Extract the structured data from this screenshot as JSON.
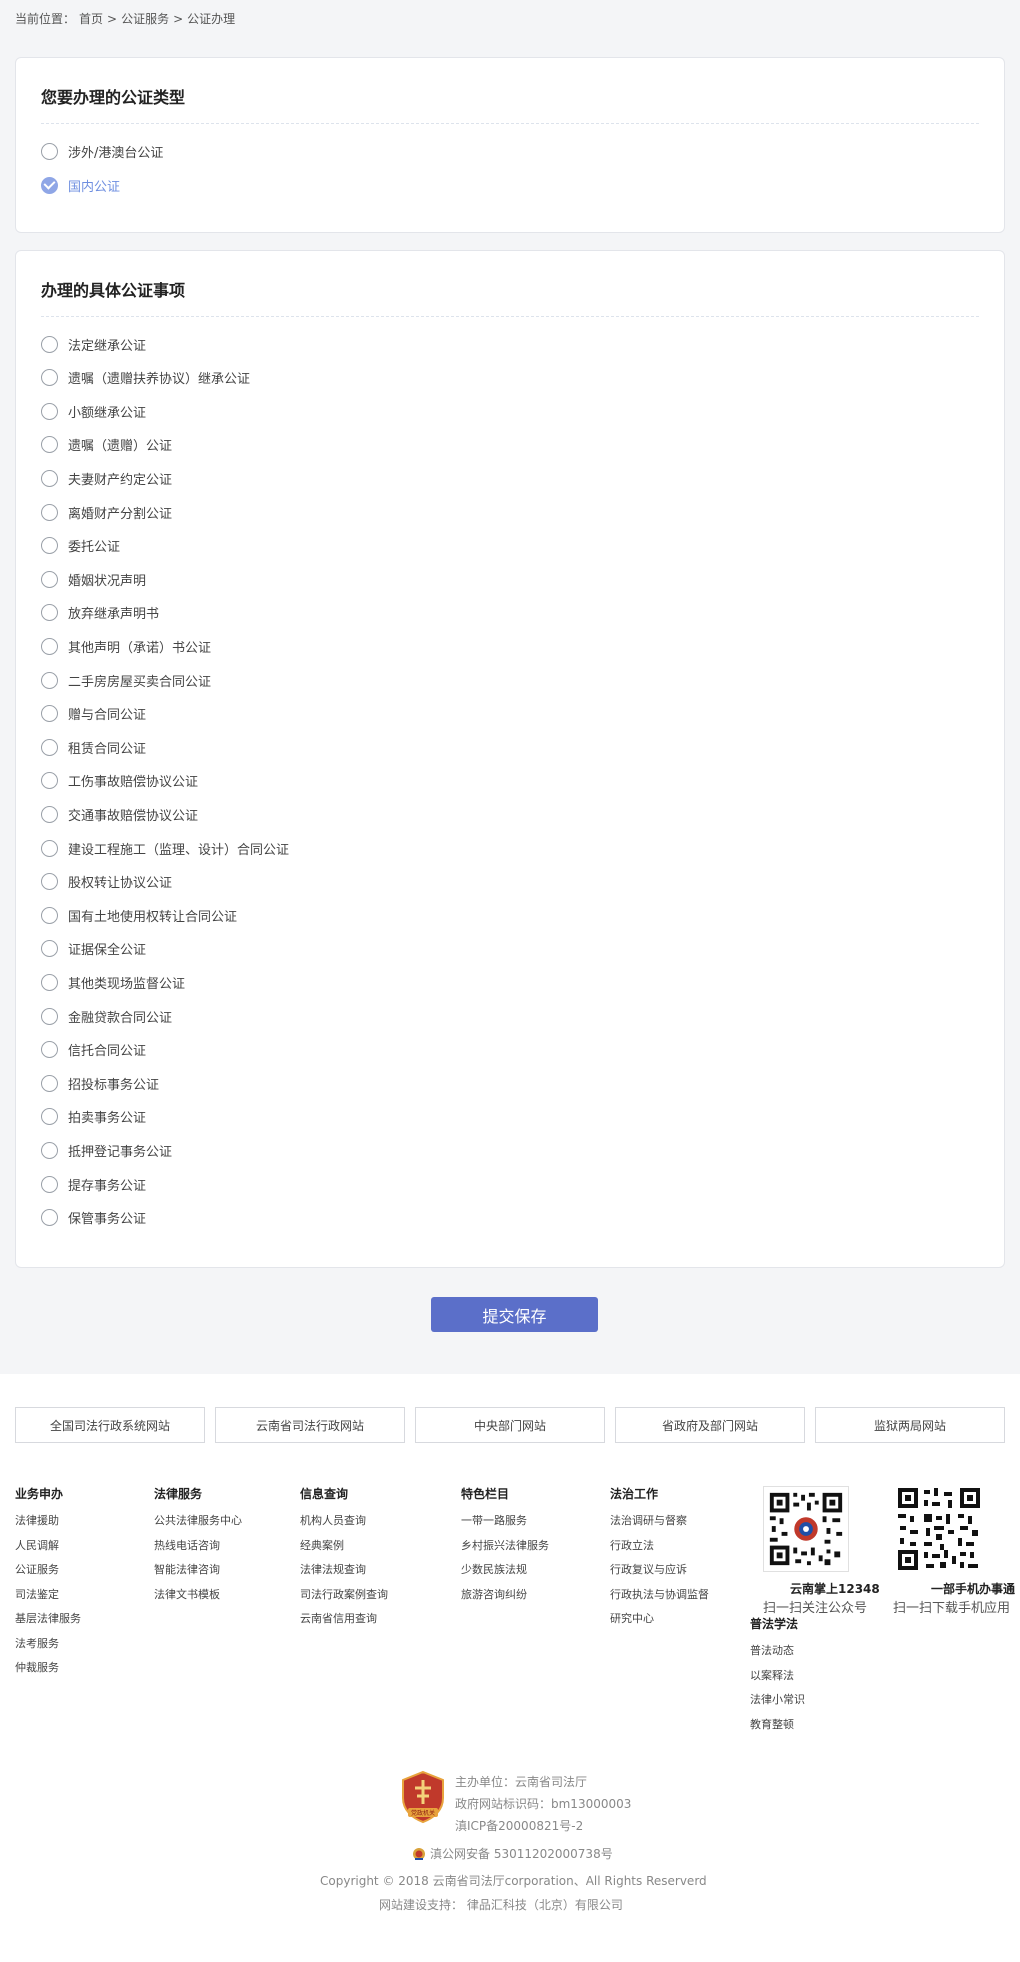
{
  "breadcrumb": {
    "prefix": "当前位置：",
    "items": [
      "首页",
      ">",
      "公证服务",
      ">",
      "公证办理"
    ]
  },
  "type_panel": {
    "title": "您要办理的公证类型",
    "options": [
      {
        "label": "涉外/港澳台公证",
        "checked": false
      },
      {
        "label": "国内公证",
        "checked": true
      }
    ]
  },
  "matter_panel": {
    "title": "办理的具体公证事项",
    "options": [
      "法定继承公证",
      "遗嘱（遗赠扶养协议）继承公证",
      "小额继承公证",
      "遗嘱（遗赠）公证",
      "夫妻财产约定公证",
      "离婚财产分割公证",
      "委托公证",
      "婚姻状况声明",
      "放弃继承声明书",
      "其他声明（承诺）书公证",
      "二手房房屋买卖合同公证",
      "赠与合同公证",
      "租赁合同公证",
      "工伤事故赔偿协议公证",
      "交通事故赔偿协议公证",
      "建设工程施工（监理、设计）合同公证",
      "股权转让协议公证",
      "国有土地使用权转让合同公证",
      "证据保全公证",
      "其他类现场监督公证",
      "金融贷款合同公证",
      "信托合同公证",
      "招投标事务公证",
      "拍卖事务公证",
      "抵押登记事务公证",
      "提存事务公证",
      "保管事务公证"
    ]
  },
  "submit_label": "提交保存",
  "site_links": [
    "全国司法行政系统网站",
    "云南省司法行政网站",
    "中央部门网站",
    "省政府及部门网站",
    "监狱两局网站"
  ],
  "footer_columns": [
    {
      "title": "业务申办",
      "links": [
        "法律援助",
        "人民调解",
        "公证服务",
        "司法鉴定",
        "基层法律服务",
        "法考服务",
        "仲裁服务"
      ]
    },
    {
      "title": "法律服务",
      "links": [
        "公共法律服务中心",
        "热线电话咨询",
        "智能法律咨询",
        "法律文书模板"
      ]
    },
    {
      "title": "信息查询",
      "links": [
        "机构人员查询",
        "经典案例",
        "法律法规查询",
        "司法行政案例查询",
        "云南省信用查询"
      ]
    },
    {
      "title": "特色栏目",
      "links": [
        "一带一路服务",
        "乡村振兴法律服务",
        "少数民族法规",
        "旅游咨询纠纷"
      ]
    },
    {
      "title": "法治工作",
      "links": [
        "法治调研与督察",
        "行政立法",
        "行政复议与应诉",
        "行政执法与协调监督",
        "研究中心"
      ]
    },
    {
      "title": "普法学法",
      "links": [
        "普法动态",
        "以案释法",
        "法律小常识",
        "教育整顿"
      ]
    }
  ],
  "qr_codes": [
    {
      "icon": "qr-code-icon",
      "caption": "云南掌上12348",
      "subcaption": "扫一扫关注公众号"
    },
    {
      "icon": "qr-code-icon",
      "caption": "一部手机办事通",
      "subcaption": "扫一扫下载手机应用"
    }
  ],
  "footer_info": {
    "sponsor": "主办单位：云南省司法厅",
    "site_code": "政府网站标识码：bm13000003",
    "icp": "滇ICP备20000821号-2",
    "emblem_text": "党政机关",
    "police_record": "滇公网安备 53011202000738号",
    "copyright": "Copyright © 2018 云南省司法厅corporation、All Rights Reserverd",
    "support": "网站建设支持：  律品汇科技（北京）有限公司"
  },
  "colors": {
    "accent": "#5b6fc9",
    "selected": "#8fa6e6",
    "page_bg": "#f4f5f7",
    "emblem_red": "#c0392b"
  }
}
